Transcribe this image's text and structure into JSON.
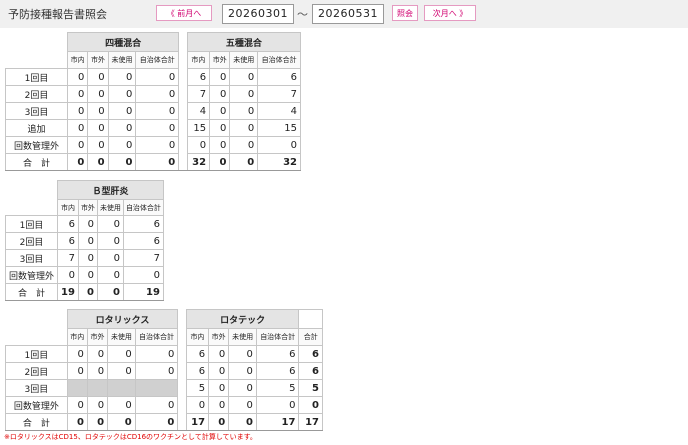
{
  "header": {
    "title": "予防接種報告書照会",
    "prev_label": "《 前月へ",
    "start_date": "20260301",
    "tilde": "〜",
    "end_date": "20260531",
    "query_label": "照会",
    "next_label": "次月へ 》"
  },
  "cols": {
    "c1": "市内",
    "c2": "市外",
    "c3": "未使用",
    "c4": "自治体合計",
    "grand": "合計"
  },
  "t1": {
    "left_title": "四種混合",
    "right_title": "五種混合",
    "rows": [
      {
        "label": "1回目",
        "l": [
          "0",
          "0",
          "0",
          "0"
        ],
        "r": [
          "6",
          "0",
          "0",
          "6"
        ]
      },
      {
        "label": "2回目",
        "l": [
          "0",
          "0",
          "0",
          "0"
        ],
        "r": [
          "7",
          "0",
          "0",
          "7"
        ]
      },
      {
        "label": "3回目",
        "l": [
          "0",
          "0",
          "0",
          "0"
        ],
        "r": [
          "4",
          "0",
          "0",
          "4"
        ]
      },
      {
        "label": "追加",
        "l": [
          "0",
          "0",
          "0",
          "0"
        ],
        "r": [
          "15",
          "0",
          "0",
          "15"
        ]
      },
      {
        "label": "回数管理外",
        "l": [
          "0",
          "0",
          "0",
          "0"
        ],
        "r": [
          "0",
          "0",
          "0",
          "0"
        ]
      },
      {
        "label": "合　計",
        "l": [
          "0",
          "0",
          "0",
          "0"
        ],
        "r": [
          "32",
          "0",
          "0",
          "32"
        ]
      }
    ]
  },
  "t2": {
    "title": "Ｂ型肝炎",
    "rows": [
      {
        "label": "1回目",
        "v": [
          "6",
          "0",
          "0",
          "6"
        ]
      },
      {
        "label": "2回目",
        "v": [
          "6",
          "0",
          "0",
          "6"
        ]
      },
      {
        "label": "3回目",
        "v": [
          "7",
          "0",
          "0",
          "7"
        ]
      },
      {
        "label": "回数管理外",
        "v": [
          "0",
          "0",
          "0",
          "0"
        ]
      },
      {
        "label": "合　計",
        "v": [
          "19",
          "0",
          "0",
          "19"
        ]
      }
    ]
  },
  "t3": {
    "left_title": "ロタリックス",
    "right_title": "ロタテック",
    "rows": [
      {
        "label": "1回目",
        "l": [
          "0",
          "0",
          "0",
          "0"
        ],
        "r": [
          "6",
          "0",
          "0",
          "6"
        ],
        "g": "6"
      },
      {
        "label": "2回目",
        "l": [
          "0",
          "0",
          "0",
          "0"
        ],
        "r": [
          "6",
          "0",
          "0",
          "6"
        ],
        "g": "6"
      },
      {
        "label": "3回目",
        "l": [
          "",
          "",
          "",
          ""
        ],
        "r": [
          "5",
          "0",
          "0",
          "5"
        ],
        "g": "5"
      },
      {
        "label": "回数管理外",
        "l": [
          "0",
          "0",
          "0",
          "0"
        ],
        "r": [
          "0",
          "0",
          "0",
          "0"
        ],
        "g": "0"
      },
      {
        "label": "合　計",
        "l": [
          "0",
          "0",
          "0",
          "0"
        ],
        "r": [
          "17",
          "0",
          "0",
          "17"
        ],
        "g": "17"
      }
    ]
  },
  "note": "※ロタリックスはCD15、ロタテックはCD16のワクチンとして計算しています。"
}
